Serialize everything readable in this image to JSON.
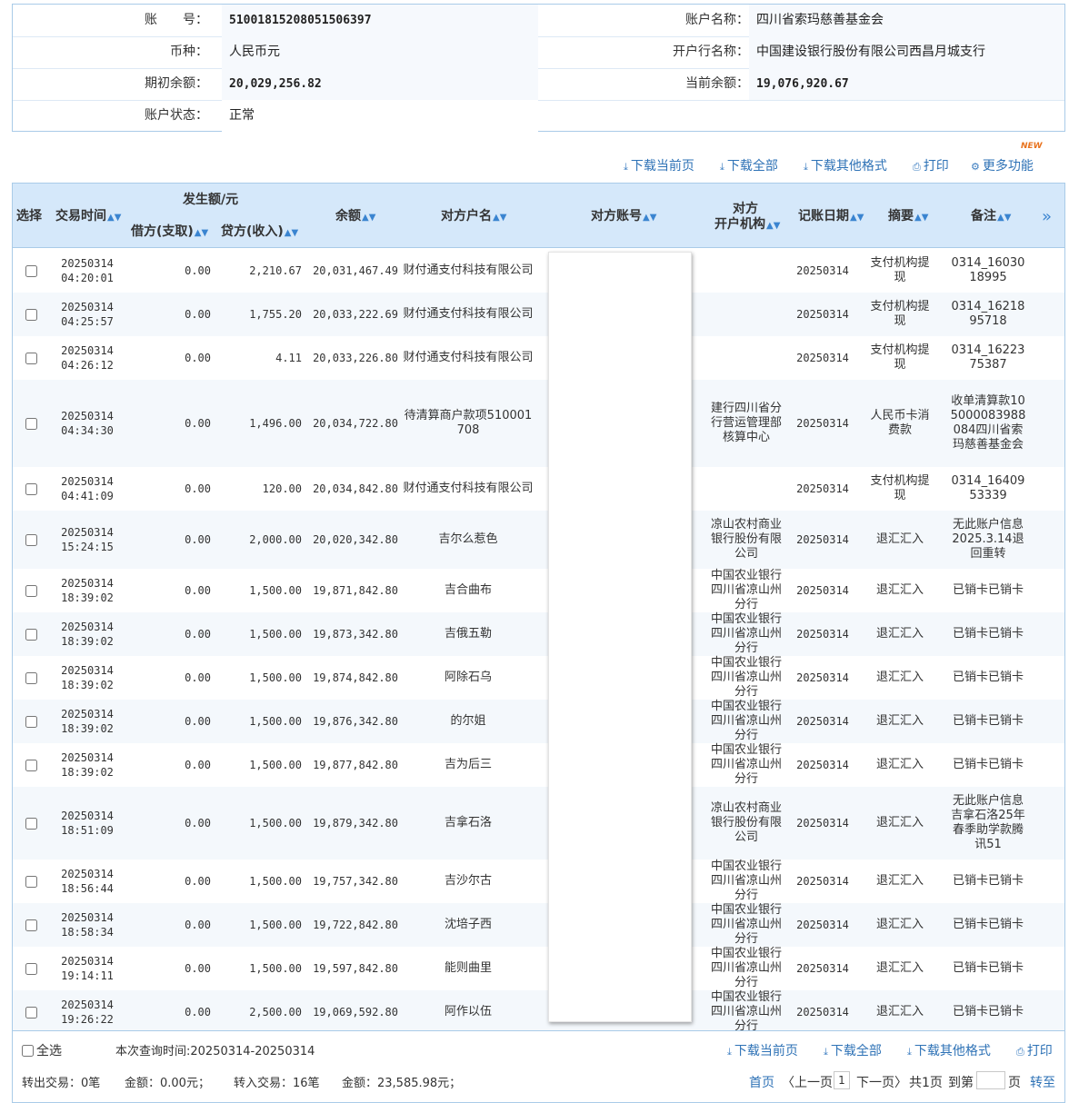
{
  "account": {
    "number_label": "账　　号：",
    "number": "51001815208051506397",
    "name_label": "账户名称：",
    "name": "四川省索玛慈善基金会",
    "currency_label": "币种：",
    "currency": "人民币元",
    "bank_label": "开户行名称：",
    "bank": "中国建设银行股份有限公司西昌月城支行",
    "opening_balance_label": "期初余额：",
    "opening_balance": "20,029,256.82",
    "current_balance_label": "当前余额：",
    "current_balance": "19,076,920.67",
    "status_label": "账户状态：",
    "status": "正常"
  },
  "toolbar": {
    "download_page": "下载当前页",
    "download_all": "下载全部",
    "download_other": "下载其他格式",
    "print": "打印",
    "more": "更多功能",
    "new_badge": "NEW"
  },
  "table": {
    "headers": {
      "select": "选择",
      "time": "交易时间",
      "amount_group": "发生额/元",
      "debit": "借方(支取)",
      "credit": "贷方(收入)",
      "balance": "余额",
      "counterparty_name": "对方户名",
      "counterparty_account": "对方账号",
      "counterparty_org_1": "对方",
      "counterparty_org_2": "开户机构",
      "post_date": "记账日期",
      "memo": "摘要",
      "note": "备注"
    },
    "rows": [
      {
        "date": "20250314",
        "time": "04:20:01",
        "debit": "0.00",
        "credit": "2,210.67",
        "balance": "20,031,467.49",
        "name": "财付通支付科技有限公司",
        "org": "",
        "post_date": "20250314",
        "memo": "支付机构提现",
        "note": "0314_1603018995"
      },
      {
        "date": "20250314",
        "time": "04:25:57",
        "debit": "0.00",
        "credit": "1,755.20",
        "balance": "20,033,222.69",
        "name": "财付通支付科技有限公司",
        "org": "",
        "post_date": "20250314",
        "memo": "支付机构提现",
        "note": "0314_1621895718"
      },
      {
        "date": "20250314",
        "time": "04:26:12",
        "debit": "0.00",
        "credit": "4.11",
        "balance": "20,033,226.80",
        "name": "财付通支付科技有限公司",
        "org": "",
        "post_date": "20250314",
        "memo": "支付机构提现",
        "note": "0314_1622375387"
      },
      {
        "date": "20250314",
        "time": "04:34:30",
        "debit": "0.00",
        "credit": "1,496.00",
        "balance": "20,034,722.80",
        "name": "待清算商户款项510001708",
        "org": "建行四川省分行营运管理部核算中心",
        "post_date": "20250314",
        "memo": "人民币卡消费款",
        "note": "收单清算款105000083988084四川省索玛慈善基金会"
      },
      {
        "date": "20250314",
        "time": "04:41:09",
        "debit": "0.00",
        "credit": "120.00",
        "balance": "20,034,842.80",
        "name": "财付通支付科技有限公司",
        "org": "",
        "post_date": "20250314",
        "memo": "支付机构提现",
        "note": "0314_1640953339"
      },
      {
        "date": "20250314",
        "time": "15:24:15",
        "debit": "0.00",
        "credit": "2,000.00",
        "balance": "20,020,342.80",
        "name": "吉尔么惹色",
        "org": "凉山农村商业银行股份有限公司",
        "post_date": "20250314",
        "memo": "退汇汇入",
        "note": "无此账户信息2025.3.14退回重转"
      },
      {
        "date": "20250314",
        "time": "18:39:02",
        "debit": "0.00",
        "credit": "1,500.00",
        "balance": "19,871,842.80",
        "name": "吉合曲布",
        "org": "中国农业银行四川省凉山州分行",
        "post_date": "20250314",
        "memo": "退汇汇入",
        "note": "已销卡已销卡"
      },
      {
        "date": "20250314",
        "time": "18:39:02",
        "debit": "0.00",
        "credit": "1,500.00",
        "balance": "19,873,342.80",
        "name": "吉俄五勒",
        "org": "中国农业银行四川省凉山州分行",
        "post_date": "20250314",
        "memo": "退汇汇入",
        "note": "已销卡已销卡"
      },
      {
        "date": "20250314",
        "time": "18:39:02",
        "debit": "0.00",
        "credit": "1,500.00",
        "balance": "19,874,842.80",
        "name": "阿除石乌",
        "org": "中国农业银行四川省凉山州分行",
        "post_date": "20250314",
        "memo": "退汇汇入",
        "note": "已销卡已销卡"
      },
      {
        "date": "20250314",
        "time": "18:39:02",
        "debit": "0.00",
        "credit": "1,500.00",
        "balance": "19,876,342.80",
        "name": "的尔姐",
        "org": "中国农业银行四川省凉山州分行",
        "post_date": "20250314",
        "memo": "退汇汇入",
        "note": "已销卡已销卡"
      },
      {
        "date": "20250314",
        "time": "18:39:02",
        "debit": "0.00",
        "credit": "1,500.00",
        "balance": "19,877,842.80",
        "name": "吉为后三",
        "org": "中国农业银行四川省凉山州分行",
        "post_date": "20250314",
        "memo": "退汇汇入",
        "note": "已销卡已销卡"
      },
      {
        "date": "20250314",
        "time": "18:51:09",
        "debit": "0.00",
        "credit": "1,500.00",
        "balance": "19,879,342.80",
        "name": "吉拿石洛",
        "org": "凉山农村商业银行股份有限公司",
        "post_date": "20250314",
        "memo": "退汇汇入",
        "note": "无此账户信息吉拿石洛25年春季助学款腾讯51"
      },
      {
        "date": "20250314",
        "time": "18:56:44",
        "debit": "0.00",
        "credit": "1,500.00",
        "balance": "19,757,342.80",
        "name": "吉沙尔古",
        "org": "中国农业银行四川省凉山州分行",
        "post_date": "20250314",
        "memo": "退汇汇入",
        "note": "已销卡已销卡"
      },
      {
        "date": "20250314",
        "time": "18:58:34",
        "debit": "0.00",
        "credit": "1,500.00",
        "balance": "19,722,842.80",
        "name": "沈培子西",
        "org": "中国农业银行四川省凉山州分行",
        "post_date": "20250314",
        "memo": "退汇汇入",
        "note": "已销卡已销卡"
      },
      {
        "date": "20250314",
        "time": "19:14:11",
        "debit": "0.00",
        "credit": "1,500.00",
        "balance": "19,597,842.80",
        "name": "能则曲里",
        "org": "中国农业银行四川省凉山州分行",
        "post_date": "20250314",
        "memo": "退汇汇入",
        "note": "已销卡已销卡"
      },
      {
        "date": "20250314",
        "time": "19:26:22",
        "debit": "0.00",
        "credit": "2,500.00",
        "balance": "19,069,592.80",
        "name": "阿作以伍",
        "org": "中国农业银行四川省凉山州分行",
        "post_date": "20250314",
        "memo": "退汇汇入",
        "note": "已销卡已销卡"
      }
    ]
  },
  "footer": {
    "select_all": "全选",
    "query_time": "本次查询时间:20250314-20250314",
    "download_page": "下载当前页",
    "download_all": "下载全部",
    "download_other": "下载其他格式",
    "print": "打印",
    "out_summary": "转出交易：0笔",
    "out_amount": "金额：0.00元；",
    "in_summary": "转入交易：16笔",
    "in_amount": "金额：23,585.98元；",
    "first_page": "首页",
    "prev_page": "〈上一页",
    "current_page": "1",
    "next_page": "下一页〉",
    "total_pages": "共1页",
    "goto_label": "到第",
    "page_unit": "页",
    "goto_button": "转至"
  }
}
